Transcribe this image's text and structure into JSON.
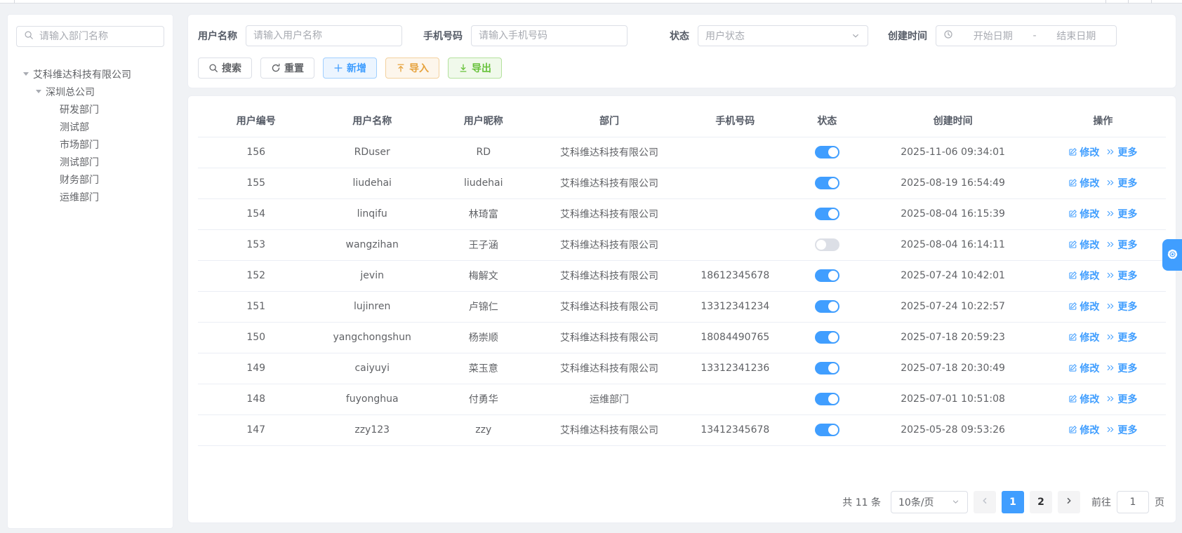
{
  "colors": {
    "accent": "#409eff",
    "warning": "#e6a23c",
    "success": "#67c23a",
    "toggle_off": "#dcdfe6"
  },
  "sidebar": {
    "search_placeholder": "请输入部门名称",
    "tree": [
      {
        "label": "艾科维达科技有限公司",
        "level": 0,
        "expanded": true
      },
      {
        "label": "深圳总公司",
        "level": 1,
        "expanded": true
      },
      {
        "label": "研发部门",
        "level": 2
      },
      {
        "label": "测试部",
        "level": 2
      },
      {
        "label": "市场部门",
        "level": 2
      },
      {
        "label": "测试部门",
        "level": 2
      },
      {
        "label": "财务部门",
        "level": 2
      },
      {
        "label": "运维部门",
        "level": 2
      }
    ]
  },
  "filters": {
    "username_label": "用户名称",
    "username_placeholder": "请输入用户名称",
    "phone_label": "手机号码",
    "phone_placeholder": "请输入手机号码",
    "status_label": "状态",
    "status_placeholder": "用户状态",
    "created_label": "创建时间",
    "date_start_placeholder": "开始日期",
    "date_separator": "-",
    "date_end_placeholder": "结束日期"
  },
  "toolbar": {
    "search_label": "搜索",
    "reset_label": "重置",
    "add_label": "新增",
    "import_label": "导入",
    "export_label": "导出"
  },
  "table": {
    "columns": [
      "用户编号",
      "用户名称",
      "用户昵称",
      "部门",
      "手机号码",
      "状态",
      "创建时间",
      "操作"
    ],
    "row_actions": {
      "edit": "修改",
      "more": "更多"
    },
    "rows": [
      {
        "id": "156",
        "name": "RDuser",
        "nick": "RD",
        "dept": "艾科维达科技有限公司",
        "phone": "",
        "status": true,
        "created": "2025-11-06 09:34:01"
      },
      {
        "id": "155",
        "name": "liudehai",
        "nick": "liudehai",
        "dept": "艾科维达科技有限公司",
        "phone": "",
        "status": true,
        "created": "2025-08-19 16:54:49"
      },
      {
        "id": "154",
        "name": "linqifu",
        "nick": "林琦富",
        "dept": "艾科维达科技有限公司",
        "phone": "",
        "status": true,
        "created": "2025-08-04 16:15:39"
      },
      {
        "id": "153",
        "name": "wangzihan",
        "nick": "王子涵",
        "dept": "艾科维达科技有限公司",
        "phone": "",
        "status": false,
        "created": "2025-08-04 16:14:11"
      },
      {
        "id": "152",
        "name": "jevin",
        "nick": "梅解文",
        "dept": "艾科维达科技有限公司",
        "phone": "18612345678",
        "status": true,
        "created": "2025-07-24 10:42:01"
      },
      {
        "id": "151",
        "name": "lujinren",
        "nick": "卢锦仁",
        "dept": "艾科维达科技有限公司",
        "phone": "13312341234",
        "status": true,
        "created": "2025-07-24 10:22:57"
      },
      {
        "id": "150",
        "name": "yangchongshun",
        "nick": "杨崇顺",
        "dept": "艾科维达科技有限公司",
        "phone": "18084490765",
        "status": true,
        "created": "2025-07-18 20:59:23"
      },
      {
        "id": "149",
        "name": "caiyuyi",
        "nick": "菜玉意",
        "dept": "艾科维达科技有限公司",
        "phone": "13312341236",
        "status": true,
        "created": "2025-07-18 20:30:49"
      },
      {
        "id": "148",
        "name": "fuyonghua",
        "nick": "付勇华",
        "dept": "运维部门",
        "phone": "",
        "status": true,
        "created": "2025-07-01 10:51:08"
      },
      {
        "id": "147",
        "name": "zzy123",
        "nick": "zzy",
        "dept": "艾科维达科技有限公司",
        "phone": "13412345678",
        "status": true,
        "created": "2025-05-28 09:53:26"
      }
    ]
  },
  "pagination": {
    "total_text": "共 11 条",
    "page_size_label": "10条/页",
    "pages": [
      "1",
      "2"
    ],
    "active_page": "1",
    "goto_label": "前往",
    "goto_value": "1",
    "goto_suffix": "页"
  }
}
